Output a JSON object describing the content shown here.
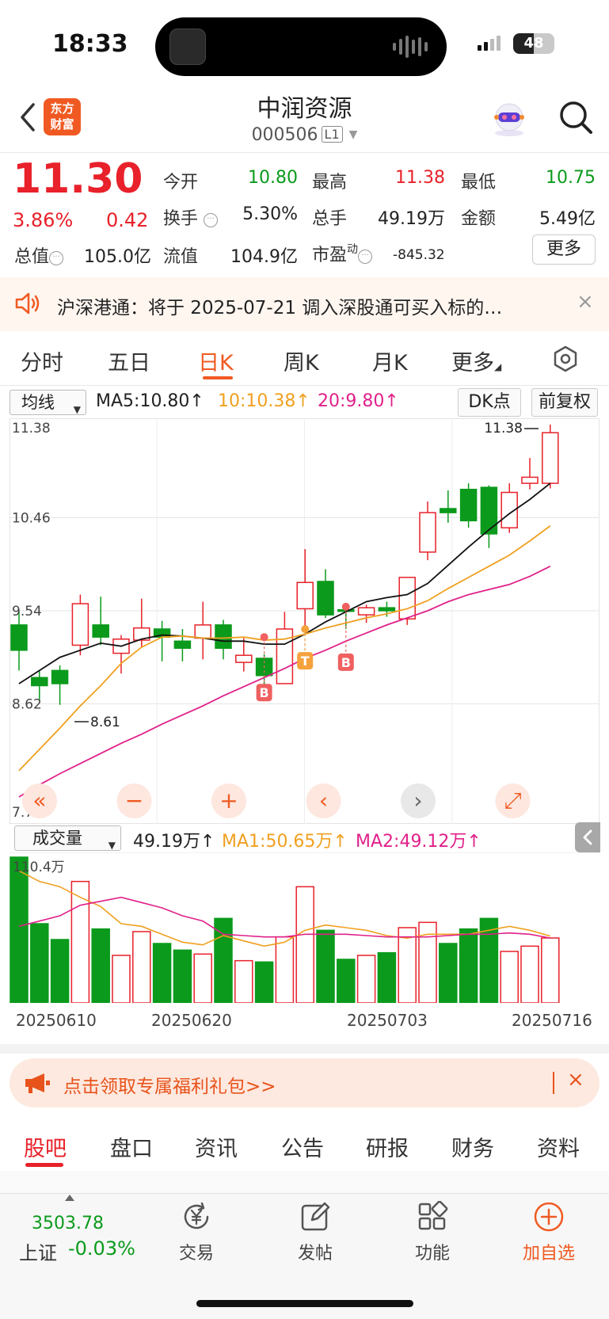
{
  "status_bar": {
    "time": "18:33",
    "battery": "48"
  },
  "header": {
    "logo_line1": "东方",
    "logo_line2": "财富",
    "stock_name": "中润资源",
    "stock_code": "000506",
    "level": "L1"
  },
  "quote": {
    "price": "11.30",
    "change_pct": "3.86%",
    "change": "0.42",
    "open_label": "今开",
    "open": "10.80",
    "high_label": "最高",
    "high": "11.38",
    "low_label": "最低",
    "low": "10.75",
    "turnover_label": "换手",
    "turnover": "5.30%",
    "volume_label": "总手",
    "volume": "49.19万",
    "amount_label": "金额",
    "amount": "5.49亿",
    "mktcap_label": "总值",
    "mktcap": "105.0亿",
    "float_label": "流值",
    "float_cap": "104.9亿",
    "pe_label": "市盈",
    "pe_sup": "动",
    "pe": "-845.32",
    "more_label": "更多"
  },
  "notice": {
    "text": "沪深港通：将于 2025-07-21 调入深股通可买入标的…",
    "close": "×"
  },
  "tabs": [
    "分时",
    "五日",
    "日K",
    "周K",
    "月K",
    "更多"
  ],
  "ma_bar": {
    "select": "均线",
    "ma5": "MA5:10.80↑",
    "ma10": "10:10.38↑",
    "ma20": "20:9.80↑",
    "dk": "DK点",
    "fq": "前复权"
  },
  "colors": {
    "up": "#e8212a",
    "down": "#0b9a1c",
    "ma5": "#111111",
    "ma10": "#f0a020",
    "ma20": "#e0218a",
    "brand": "#f05a22"
  },
  "chart_data": [
    {
      "type": "candlestick",
      "title": "",
      "price_axis_labels": [
        "11.38",
        "10.46",
        "9.54",
        "8.62",
        "7.70"
      ],
      "ylim": [
        7.7,
        11.38
      ],
      "annotations": {
        "high_marker": "11.38",
        "low_marker": "8.61",
        "signals": [
          "B",
          "T",
          "B"
        ]
      },
      "candles": [
        {
          "o": 9.4,
          "c": 9.15,
          "h": 9.53,
          "l": 8.95
        },
        {
          "o": 8.88,
          "c": 8.8,
          "h": 8.95,
          "l": 8.65
        },
        {
          "o": 8.95,
          "c": 8.82,
          "h": 9.0,
          "l": 8.61
        },
        {
          "o": 9.2,
          "c": 9.61,
          "h": 9.7,
          "l": 9.1
        },
        {
          "o": 9.4,
          "c": 9.28,
          "h": 9.68,
          "l": 9.2
        },
        {
          "o": 9.12,
          "c": 9.26,
          "h": 9.3,
          "l": 8.92
        },
        {
          "o": 9.25,
          "c": 9.37,
          "h": 9.66,
          "l": 9.18
        },
        {
          "o": 9.36,
          "c": 9.28,
          "h": 9.44,
          "l": 9.04
        },
        {
          "o": 9.24,
          "c": 9.17,
          "h": 9.36,
          "l": 9.04
        },
        {
          "o": 9.27,
          "c": 9.4,
          "h": 9.63,
          "l": 9.06
        },
        {
          "o": 9.4,
          "c": 9.17,
          "h": 9.45,
          "l": 9.06
        },
        {
          "o": 9.03,
          "c": 9.1,
          "h": 9.27,
          "l": 8.94
        },
        {
          "o": 9.07,
          "c": 8.9,
          "h": 9.11,
          "l": 8.78
        },
        {
          "o": 8.82,
          "c": 9.36,
          "h": 9.53,
          "l": 8.82
        },
        {
          "o": 9.56,
          "c": 9.82,
          "h": 10.15,
          "l": 9.36
        },
        {
          "o": 9.83,
          "c": 9.5,
          "h": 9.95,
          "l": 9.47
        },
        {
          "o": 9.55,
          "c": 9.54,
          "h": 9.58,
          "l": 9.36
        },
        {
          "o": 9.5,
          "c": 9.57,
          "h": 9.6,
          "l": 9.42
        },
        {
          "o": 9.57,
          "c": 9.54,
          "h": 9.63,
          "l": 9.48
        },
        {
          "o": 9.46,
          "c": 9.87,
          "h": 9.87,
          "l": 9.4
        },
        {
          "o": 10.12,
          "c": 10.51,
          "h": 10.62,
          "l": 10.04
        },
        {
          "o": 10.55,
          "c": 10.51,
          "h": 10.73,
          "l": 10.41
        },
        {
          "o": 10.74,
          "c": 10.43,
          "h": 10.8,
          "l": 10.36
        },
        {
          "o": 10.76,
          "c": 10.3,
          "h": 10.78,
          "l": 10.16
        },
        {
          "o": 10.36,
          "c": 10.71,
          "h": 10.8,
          "l": 10.31
        },
        {
          "o": 10.8,
          "c": 10.86,
          "h": 11.05,
          "l": 10.74
        },
        {
          "o": 10.8,
          "c": 11.3,
          "h": 11.38,
          "l": 10.75
        }
      ],
      "ma5": [
        8.82,
        8.95,
        9.08,
        9.15,
        9.22,
        9.19,
        9.26,
        9.3,
        9.29,
        9.27,
        9.24,
        9.24,
        9.21,
        9.21,
        9.31,
        9.43,
        9.53,
        9.63,
        9.67,
        9.7,
        9.81,
        9.99,
        10.17,
        10.34,
        10.5,
        10.64,
        10.8
      ],
      "ma10": [
        7.96,
        8.17,
        8.38,
        8.6,
        8.8,
        9.02,
        9.18,
        9.28,
        9.29,
        9.27,
        9.27,
        9.28,
        9.25,
        9.26,
        9.31,
        9.37,
        9.42,
        9.47,
        9.51,
        9.56,
        9.64,
        9.76,
        9.87,
        9.98,
        10.09,
        10.23,
        10.38
      ],
      "ma20": [
        7.7,
        7.82,
        7.93,
        8.03,
        8.13,
        8.23,
        8.32,
        8.42,
        8.51,
        8.6,
        8.7,
        8.79,
        8.88,
        8.97,
        9.07,
        9.15,
        9.24,
        9.32,
        9.4,
        9.47,
        9.54,
        9.63,
        9.7,
        9.75,
        9.8,
        9.88,
        9.98
      ]
    },
    {
      "type": "bar",
      "title": "",
      "axis_label": "110.4万",
      "ylim": [
        0,
        110.4
      ],
      "volume_wan": [
        110.4,
        60,
        48,
        92,
        56,
        36,
        54,
        45,
        40,
        37,
        64,
        32,
        31,
        50,
        88,
        55,
        33,
        36,
        38,
        57,
        61,
        45,
        56,
        64,
        39,
        43,
        49.19
      ],
      "ma1": [
        100,
        92,
        88,
        80,
        73,
        60,
        58,
        52,
        46,
        44,
        51,
        47,
        43,
        46,
        55,
        59,
        57,
        55,
        51,
        49,
        52,
        52,
        52,
        55,
        58,
        55,
        50.65
      ],
      "ma2": [
        58,
        62,
        66,
        74,
        77,
        80,
        76,
        72,
        66,
        62,
        52,
        51,
        50,
        50,
        52,
        52,
        52,
        51,
        50,
        50,
        50,
        51,
        52,
        52,
        53,
        52,
        49.12
      ],
      "date_labels": [
        "20250610",
        "20250620",
        "20250703",
        "20250716"
      ]
    }
  ],
  "volume_bar": {
    "select": "成交量",
    "value": "49.19万↑",
    "ma1": "MA1:50.65万↑",
    "ma2": "MA2:49.12万↑"
  },
  "promo": {
    "text": "点击领取专属福利礼包>>",
    "close": "×"
  },
  "bottom_tabs": [
    "股吧",
    "盘口",
    "资讯",
    "公告",
    "研报",
    "财务",
    "资料"
  ],
  "bottom_nav": {
    "index_value": "3503.78",
    "index_name": "上证",
    "index_pct": "-0.03%",
    "trade": "交易",
    "post": "发帖",
    "functions": "功能",
    "add": "加自选"
  }
}
